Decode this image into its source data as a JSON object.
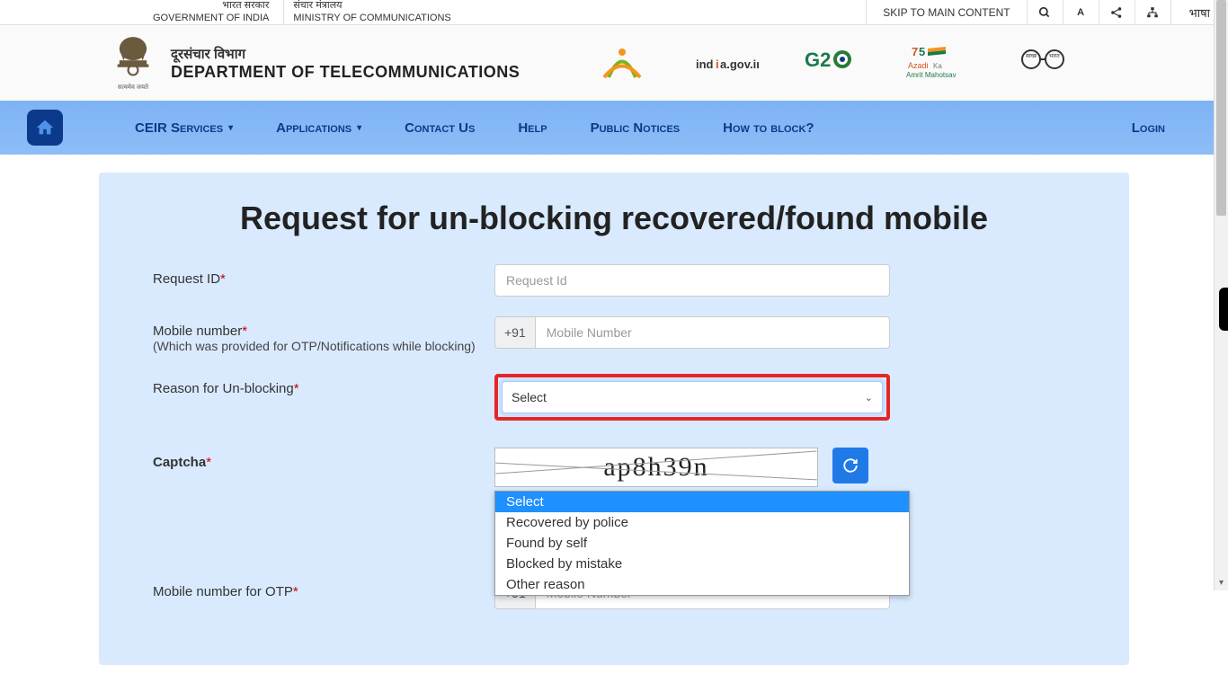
{
  "topbar": {
    "gov_hindi": "भारत सरकार",
    "gov_english": "GOVERNMENT OF INDIA",
    "ministry_hindi": "संचार मंत्रालय",
    "ministry_english": "MINISTRY OF COMMUNICATIONS",
    "skip": "SKIP TO MAIN CONTENT",
    "font_size_label": "A",
    "language": "भाषा"
  },
  "header": {
    "emblem_sub": "सत्यमेव जयते",
    "dept_hindi": "दूरसंचार विभाग",
    "dept_english": "DEPARTMENT OF TELECOMMUNICATIONS"
  },
  "nav": {
    "items": [
      "CEIR Services",
      "Applications",
      "Contact Us",
      "Help",
      "Public Notices",
      "How to block?"
    ],
    "login": "Login"
  },
  "form": {
    "title": "Request for un-blocking recovered/found mobile",
    "request_id_label": "Request ID",
    "request_id_placeholder": "Request Id",
    "mobile_label": "Mobile number",
    "mobile_hint": "(Which was provided for OTP/Notifications while blocking)",
    "mobile_prefix": "+91",
    "mobile_placeholder": "Mobile Number",
    "reason_label": "Reason for Un-blocking",
    "reason_selected": "Select",
    "reason_options": [
      "Select",
      "Recovered by police",
      "Found by self",
      "Blocked by mistake",
      "Other reason"
    ],
    "captcha_label": "Captcha",
    "captcha_value": "ap8h39n",
    "otp_mobile_label": "Mobile number for OTP",
    "otp_mobile_prefix": "+91",
    "otp_mobile_placeholder": "Mobile Number"
  }
}
